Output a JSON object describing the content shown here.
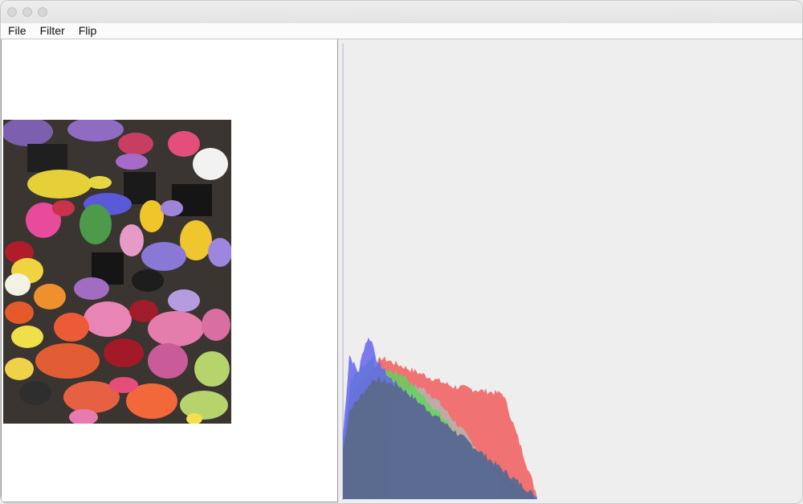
{
  "window": {
    "title": ""
  },
  "menu": {
    "items": [
      "File",
      "Filter",
      "Flip"
    ]
  },
  "image_panel": {
    "content": "flower market photo"
  },
  "histogram": {
    "channels": [
      {
        "name": "red",
        "color": "#f06464"
      },
      {
        "name": "green",
        "color": "#5cd65c"
      },
      {
        "name": "blue",
        "color": "#6464f0"
      },
      {
        "name": "overlap",
        "color": "#5b6a8c"
      }
    ]
  },
  "colors": {
    "panel_bg": "#eeeeee",
    "image_bg": "#ffffff"
  }
}
